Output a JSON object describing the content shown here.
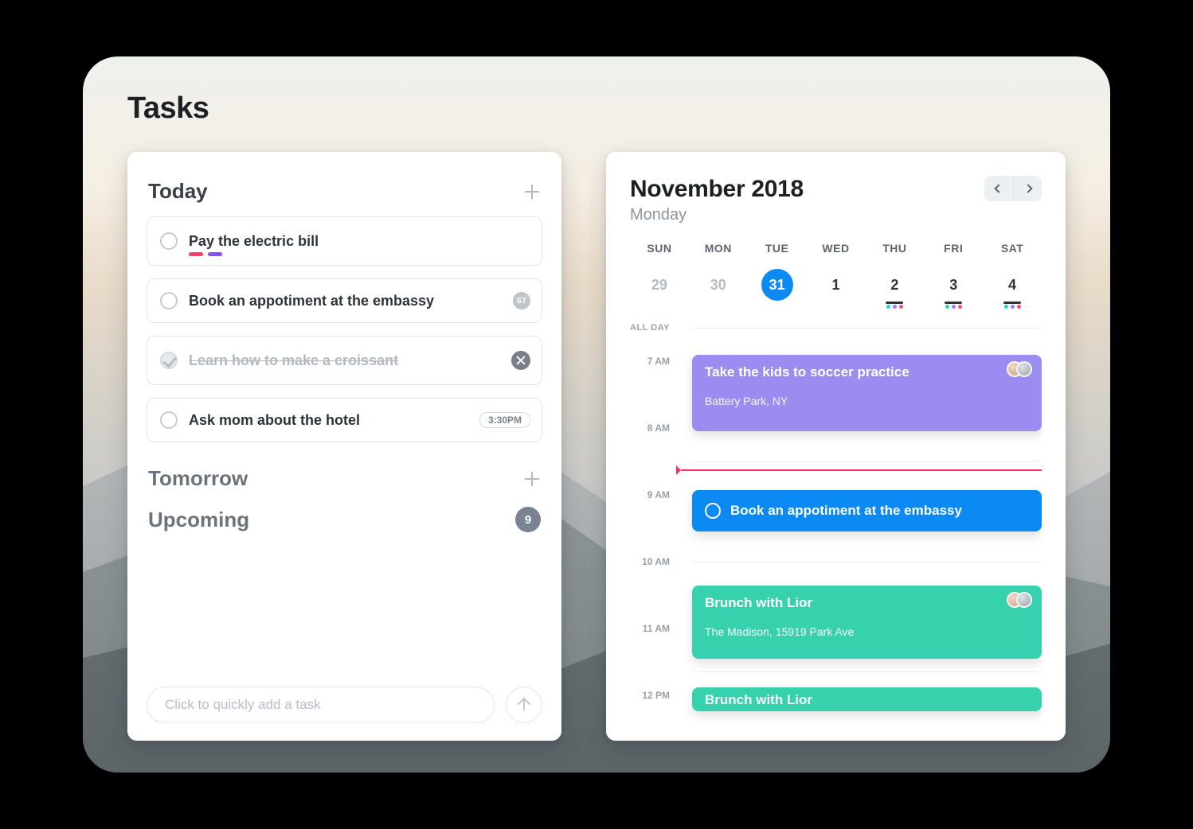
{
  "page_title": "Tasks",
  "tasks": {
    "sections": {
      "today": {
        "title": "Today",
        "items": [
          {
            "title": "Pay the electric bill",
            "tags": [
              "red",
              "purple"
            ]
          },
          {
            "title": "Book an appotiment at the embassy",
            "subtasks_badge": "ST"
          },
          {
            "title": "Learn how to make a croissant",
            "completed": true
          },
          {
            "title": "Ask mom about the hotel",
            "time_pill": "3:30PM"
          }
        ]
      },
      "tomorrow": {
        "title": "Tomorrow"
      },
      "upcoming": {
        "title": "Upcoming",
        "count": "9"
      }
    },
    "quick_add_placeholder": "Click to quickly add a task"
  },
  "calendar": {
    "month_year": "November 2018",
    "weekday": "Monday",
    "dow": [
      "SUN",
      "MON",
      "TUE",
      "WED",
      "THU",
      "FRI",
      "SAT"
    ],
    "dates": [
      {
        "label": "29",
        "muted": true
      },
      {
        "label": "30",
        "muted": true
      },
      {
        "label": "31",
        "selected": true
      },
      {
        "label": "1"
      },
      {
        "label": "2",
        "underline": true,
        "dots": [
          "cyan",
          "purple",
          "pink"
        ]
      },
      {
        "label": "3",
        "underline": true,
        "dots": [
          "cyan",
          "purple",
          "pink"
        ]
      },
      {
        "label": "4",
        "underline": true,
        "dots": [
          "cyan",
          "purple",
          "pink"
        ]
      }
    ],
    "all_day_label": "ALL DAY",
    "time_labels": [
      "7 AM",
      "8 AM",
      "9 AM",
      "10 AM",
      "11 AM",
      "12 PM"
    ],
    "events": [
      {
        "title": "Take the kids to soccer practice",
        "location": "Battery Park, NY",
        "color": "purple",
        "avatars": 2
      },
      {
        "title": "Book an appotiment at the embassy",
        "color": "blue",
        "ring": true
      },
      {
        "title": "Brunch with Lior",
        "location": "The Madison, 15919 Park Ave",
        "color": "teal",
        "avatars": 2
      },
      {
        "title": "Brunch with Lior",
        "color": "teal"
      }
    ]
  }
}
